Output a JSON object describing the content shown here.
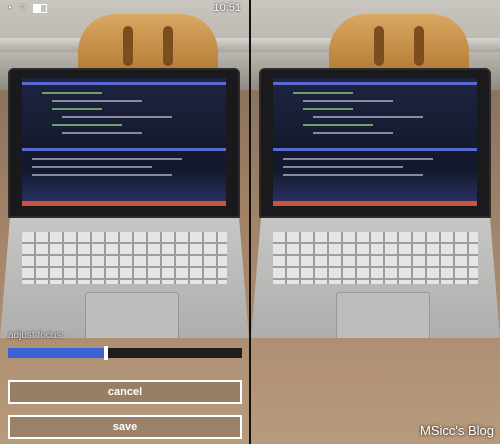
{
  "status_bar": {
    "time": "10:51",
    "icons": [
      "signal-icon",
      "wifi-icon",
      "message-icon"
    ]
  },
  "focus": {
    "label": "adjust focus:",
    "level": 0.42
  },
  "buttons": {
    "cancel": "cancel",
    "save": "save"
  },
  "watermark": "MSicc's Blog",
  "colors": {
    "slider_fill": "#3a63d8",
    "button_border": "#ffffff"
  }
}
